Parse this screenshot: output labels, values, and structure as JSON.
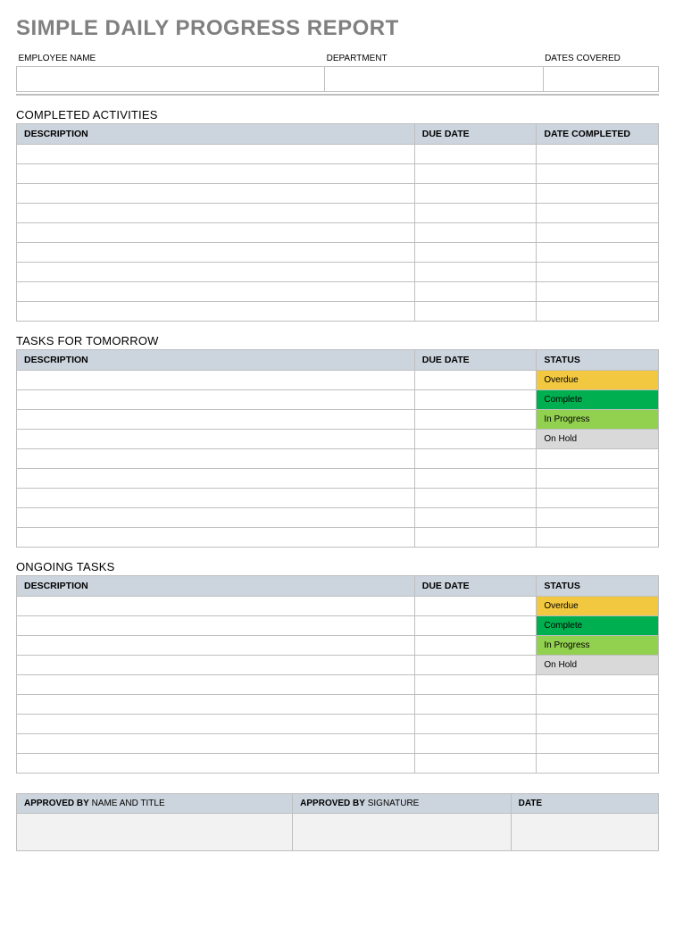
{
  "title": "SIMPLE DAILY PROGRESS REPORT",
  "info": {
    "employee_label": "EMPLOYEE NAME",
    "department_label": "DEPARTMENT",
    "dates_label": "DATES COVERED",
    "employee_value": "",
    "department_value": "",
    "dates_value": ""
  },
  "completed": {
    "title": "COMPLETED ACTIVITIES",
    "headers": {
      "description": "DESCRIPTION",
      "due": "DUE DATE",
      "done": "DATE COMPLETED"
    },
    "rows": 9
  },
  "tomorrow": {
    "title": "TASKS FOR TOMORROW",
    "headers": {
      "description": "DESCRIPTION",
      "due": "DUE DATE",
      "status": "STATUS"
    },
    "status_labels": {
      "overdue": "Overdue",
      "complete": "Complete",
      "inprog": "In Progress",
      "onhold": "On Hold"
    },
    "blank_rows": 5
  },
  "ongoing": {
    "title": "ONGOING TASKS",
    "headers": {
      "description": "DESCRIPTION",
      "due": "DUE DATE",
      "status": "STATUS"
    },
    "status_labels": {
      "overdue": "Overdue",
      "complete": "Complete",
      "inprog": "In Progress",
      "onhold": "On Hold"
    },
    "blank_rows": 5
  },
  "approval": {
    "approved_by_bold": "APPROVED BY",
    "name_title": " NAME AND TITLE",
    "signature": " SIGNATURE",
    "date": "DATE"
  }
}
